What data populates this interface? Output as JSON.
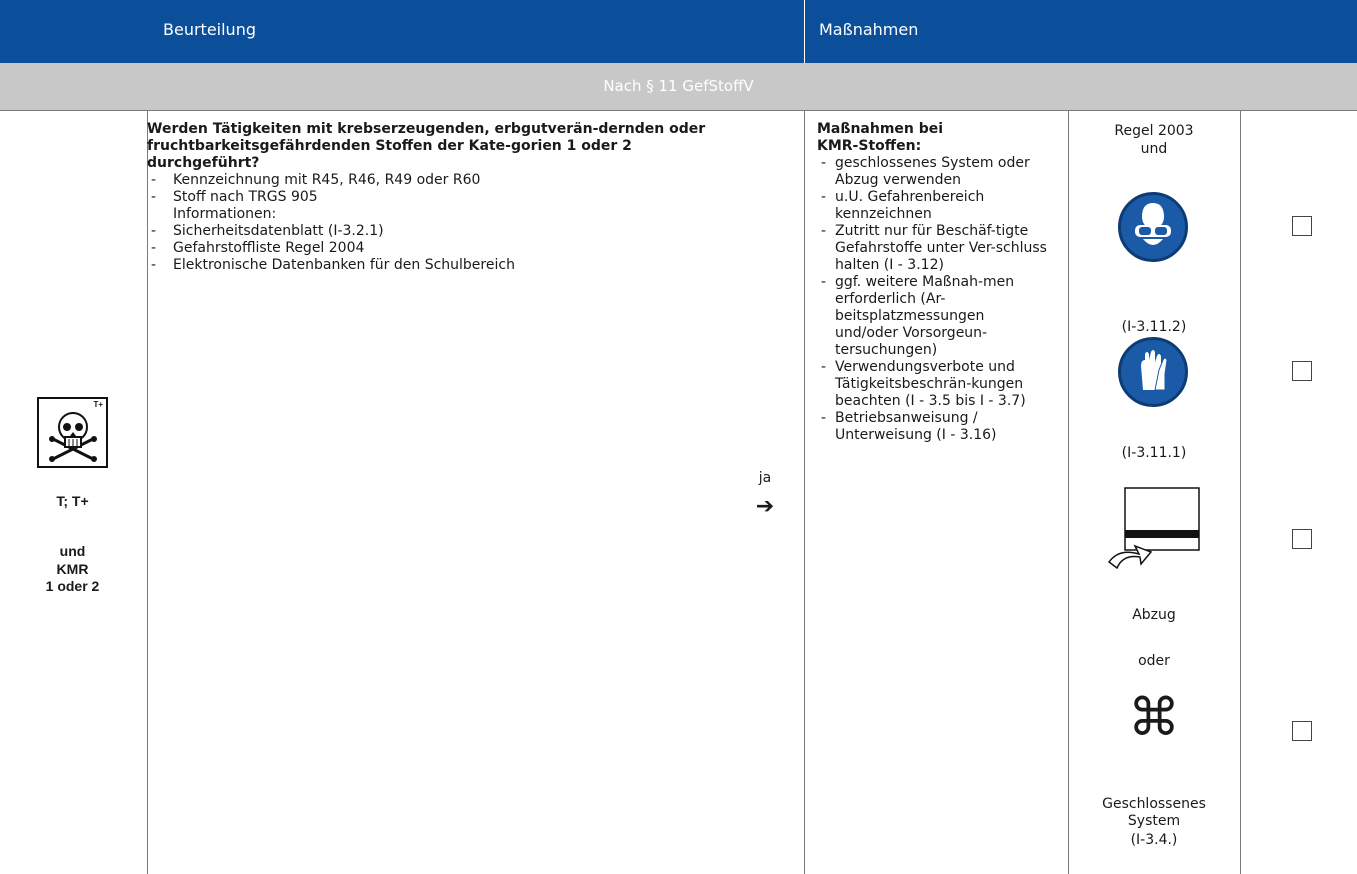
{
  "header": {
    "col_left": "Beurteilung",
    "col_right": "Maßnahmen"
  },
  "section": {
    "title": "Nach § 11 GefStoffV"
  },
  "left": {
    "hazard_code": "T+",
    "class_label": "T; T+",
    "and_label": "und",
    "kmr_label": "KMR",
    "category_label": "1 oder 2"
  },
  "assessment": {
    "question": "Werden Tätigkeiten mit krebserzeugenden, erbgutverän-dernden oder fruchtbarkeitsgefährdenden Stoffen der Kate-gorien 1 oder 2 durchgeführt?",
    "items": [
      "Kennzeichnung mit R45, R46, R49 oder R60",
      "Stoff nach TRGS 905",
      "Informationen:",
      "Sicherheitsdatenblatt (I-3.2.1)",
      "Gefahrstoffliste Regel 2004",
      "Elektronische Datenbanken für den Schulbereich"
    ]
  },
  "arrow": {
    "label": "ja",
    "glyph": "➔"
  },
  "measures": {
    "title": "Maßnahmen bei KMR-Stoffen:",
    "items": [
      "geschlossenes System oder Abzug verwenden",
      "u.U. Gefahrenbereich kennzeichnen",
      "Zutritt nur für Beschäf-tigte",
      "Gefahrstoffe unter Ver-schluss halten (I - 3.12)",
      "ggf. weitere Maßnah-men erforderlich (Ar-beitsplatzmessungen und/oder Vorsorgeun-tersuchungen)",
      "Verwendungsverbote und Tätigkeitsbeschrän-kungen beachten (I - 3.5 bis I - 3.7)",
      "Betriebsanweisung / Unterweisung (I - 3.16)"
    ]
  },
  "icons": {
    "rule": "Regel 2003",
    "rule_and": "und",
    "goggles_ref": "(I-3.11.2)",
    "gloves_ref": "(I-3.11.1)",
    "hood_label": "Abzug",
    "or_label": "oder",
    "closed_symbol": "⌘",
    "closed_label": "Geschlossenes System",
    "closed_ref": "(I-3.4.)"
  },
  "colors": {
    "header_blue": "#0b4f9a",
    "section_gray": "#c8c8c8",
    "icon_blue": "#1b5aa6"
  }
}
